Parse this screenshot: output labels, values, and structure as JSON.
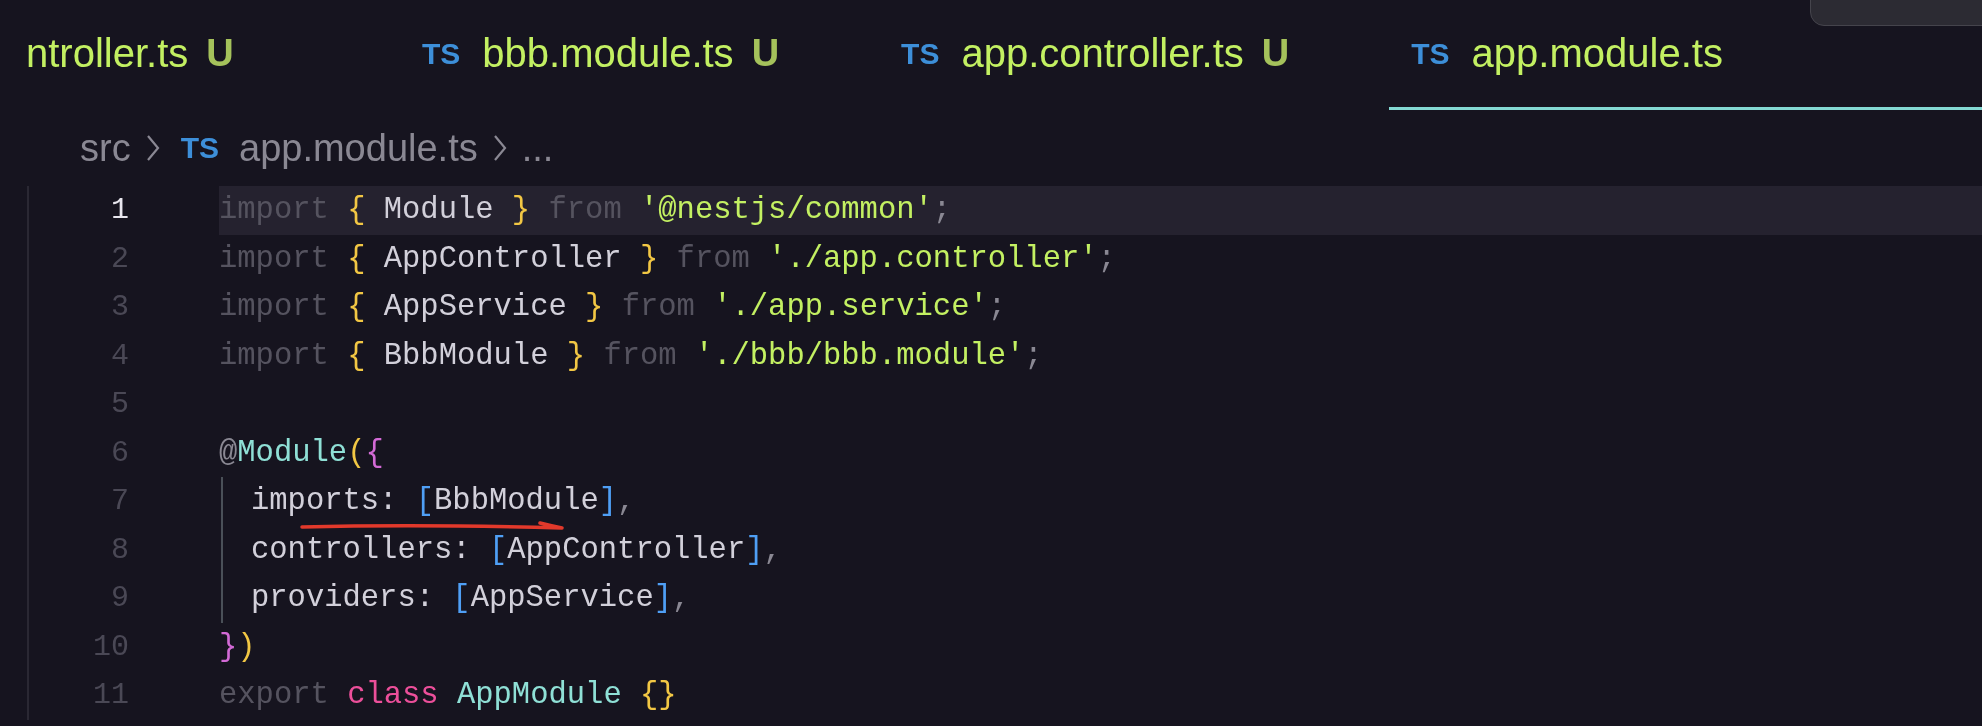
{
  "tabs": [
    {
      "label": "ntroller.ts",
      "status": "U",
      "selected": false
    },
    {
      "icon_text": "TS",
      "label": "bbb.module.ts",
      "status": "U",
      "selected": false
    },
    {
      "icon_text": "TS",
      "label": "app.controller.ts",
      "status": "U",
      "selected": false
    },
    {
      "icon_text": "TS",
      "label": "app.module.ts",
      "selected": true
    }
  ],
  "breadcrumb": {
    "folder": "src",
    "icon_text": "TS",
    "file": "app.module.ts",
    "more": "..."
  },
  "lines": [
    {
      "number": "1",
      "active": true,
      "indented": false,
      "tokens": [
        {
          "text": "import ",
          "kind": "keyword"
        },
        {
          "text": "{ ",
          "kind": "brace"
        },
        {
          "text": "Module ",
          "kind": "ident"
        },
        {
          "text": "} ",
          "kind": "brace"
        },
        {
          "text": "from ",
          "kind": "keyword"
        },
        {
          "text": "'@nestjs/common'",
          "kind": "string"
        },
        {
          "text": ";",
          "kind": "punct"
        }
      ]
    },
    {
      "number": "2",
      "active": false,
      "indented": false,
      "tokens": [
        {
          "text": "import ",
          "kind": "keyword"
        },
        {
          "text": "{ ",
          "kind": "brace"
        },
        {
          "text": "AppController ",
          "kind": "ident"
        },
        {
          "text": "} ",
          "kind": "brace"
        },
        {
          "text": "from ",
          "kind": "keyword"
        },
        {
          "text": "'./app.controller'",
          "kind": "string"
        },
        {
          "text": ";",
          "kind": "punct"
        }
      ]
    },
    {
      "number": "3",
      "active": false,
      "indented": false,
      "tokens": [
        {
          "text": "import ",
          "kind": "keyword"
        },
        {
          "text": "{ ",
          "kind": "brace"
        },
        {
          "text": "AppService ",
          "kind": "ident"
        },
        {
          "text": "} ",
          "kind": "brace"
        },
        {
          "text": "from ",
          "kind": "keyword"
        },
        {
          "text": "'./app.service'",
          "kind": "string"
        },
        {
          "text": ";",
          "kind": "punct"
        }
      ]
    },
    {
      "number": "4",
      "active": false,
      "indented": false,
      "tokens": [
        {
          "text": "import ",
          "kind": "keyword"
        },
        {
          "text": "{ ",
          "kind": "brace"
        },
        {
          "text": "BbbModule ",
          "kind": "ident"
        },
        {
          "text": "} ",
          "kind": "brace"
        },
        {
          "text": "from ",
          "kind": "keyword"
        },
        {
          "text": "'./bbb/bbb.module'",
          "kind": "string"
        },
        {
          "text": ";",
          "kind": "punct"
        }
      ]
    },
    {
      "number": "5",
      "active": false,
      "indented": false
    },
    {
      "number": "6",
      "active": false,
      "indented": false,
      "tokens": [
        {
          "text": "@",
          "kind": "punct"
        },
        {
          "text": "Module",
          "kind": "type"
        },
        {
          "text": "(",
          "kind": "brace"
        },
        {
          "text": "{",
          "kind": "brace2"
        }
      ]
    },
    {
      "number": "7",
      "active": false,
      "indented": true,
      "tokens": [
        {
          "text": "imports: ",
          "kind": "ident"
        },
        {
          "text": "[",
          "kind": "bracket"
        },
        {
          "text": "BbbModule",
          "kind": "ident"
        },
        {
          "text": "]",
          "kind": "bracket"
        },
        {
          "text": ",",
          "kind": "punct"
        }
      ]
    },
    {
      "number": "8",
      "active": false,
      "indented": true,
      "tokens": [
        {
          "text": "controllers: ",
          "kind": "ident"
        },
        {
          "text": "[",
          "kind": "bracket"
        },
        {
          "text": "AppController",
          "kind": "ident"
        },
        {
          "text": "]",
          "kind": "bracket"
        },
        {
          "text": ",",
          "kind": "punct"
        }
      ]
    },
    {
      "number": "9",
      "active": false,
      "indented": true,
      "tokens": [
        {
          "text": "providers: ",
          "kind": "ident"
        },
        {
          "text": "[",
          "kind": "bracket"
        },
        {
          "text": "AppService",
          "kind": "ident"
        },
        {
          "text": "]",
          "kind": "bracket"
        },
        {
          "text": ",",
          "kind": "punct"
        }
      ]
    },
    {
      "number": "10",
      "active": false,
      "indented": false,
      "tokens": [
        {
          "text": "}",
          "kind": "brace2"
        },
        {
          "text": ")",
          "kind": "brace"
        }
      ]
    },
    {
      "number": "11",
      "active": false,
      "indented": false,
      "tokens": [
        {
          "text": "export ",
          "kind": "keyword"
        },
        {
          "text": "class ",
          "kind": "storage"
        },
        {
          "text": "AppModule ",
          "kind": "type"
        },
        {
          "text": "{}",
          "kind": "brace"
        }
      ]
    }
  ]
}
